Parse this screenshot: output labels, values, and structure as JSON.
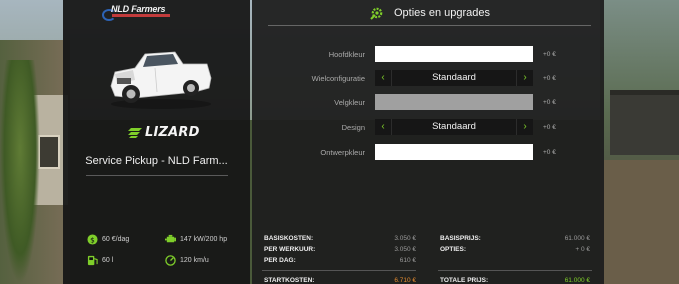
{
  "brand": {
    "logo_text": "NLD Farmers"
  },
  "vehicle": {
    "make": "LIZARD",
    "name": "Service Pickup - NLD Farm...",
    "stats": [
      {
        "icon": "money-icon",
        "value": "60 €/dag"
      },
      {
        "icon": "engine-icon",
        "value": "147 kW/200 hp"
      },
      {
        "icon": "fuel-icon",
        "value": "60 l"
      },
      {
        "icon": "speedometer-icon",
        "value": "120 km/u"
      }
    ]
  },
  "options": {
    "title": "Opties en upgrades",
    "header_icon": "wrench-gear-icon",
    "rows": [
      {
        "label": "Hoofdkleur",
        "type": "color",
        "price": "+0 €"
      },
      {
        "label": "Wielconfiguratie",
        "type": "selector",
        "value": "Standaard",
        "price": "+0 €"
      },
      {
        "label": "Velgkleur",
        "type": "color-disabled",
        "price": "+0 €"
      },
      {
        "label": "Design",
        "type": "selector",
        "value": "Standaard",
        "price": "+0 €"
      },
      {
        "label": "Ontwerpkleur",
        "type": "color",
        "price": "+0 €"
      }
    ]
  },
  "pricing": {
    "left": [
      {
        "label": "BASISKOSTEN:",
        "value": "3.050 €"
      },
      {
        "label": "PER WERKUUR:",
        "value": "3.050 €"
      },
      {
        "label": "PER DAG:",
        "value": "610 €"
      },
      {
        "label": "STARTKOSTEN:",
        "value": "6.710 €"
      }
    ],
    "right": [
      {
        "label": "BASISPRIJS:",
        "value": "61.000 €"
      },
      {
        "label": "OPTIES:",
        "value": "+ 0 €"
      },
      {
        "label": "TOTALE PRIJS:",
        "value": "61.000 €"
      }
    ]
  },
  "colors": {
    "accent": "#7fcf2a",
    "startkosten": "#e38a2f",
    "totaal": "#7fcf2a",
    "panel": "#1e1e1e"
  }
}
